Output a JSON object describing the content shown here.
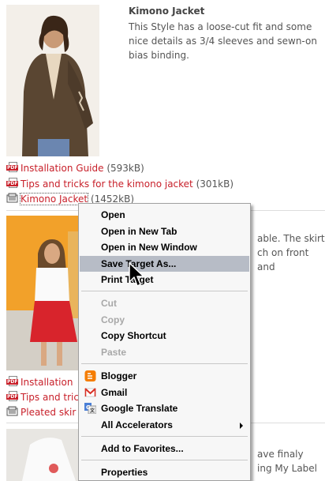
{
  "products": [
    {
      "title": "Kimono Jacket",
      "description": "This Style has a loose-cut fit and some nice details as 3/4 sleeves and sewn-on bias binding.",
      "links": [
        {
          "icon": "pdf-icon",
          "label": "Installation Guide",
          "size": "(593kB)"
        },
        {
          "icon": "pdf-icon",
          "label": "Tips and tricks for the kimono jacket",
          "size": "(301kB)"
        },
        {
          "icon": "document-icon",
          "label": "Kimono Jacket",
          "size": "(1452kB)"
        }
      ]
    },
    {
      "description_partial": [
        "able. The skirt",
        "ch on front and"
      ],
      "links": [
        {
          "icon": "pdf-icon",
          "label": "Installation"
        },
        {
          "icon": "pdf-icon",
          "label": "Tips and tric"
        },
        {
          "icon": "document-icon",
          "label": "Pleated skir"
        }
      ]
    },
    {
      "description_partial": [
        "ave finaly",
        "ing My Label"
      ]
    }
  ],
  "context_menu": {
    "items": [
      {
        "label": "Open",
        "enabled": true
      },
      {
        "label": "Open in New Tab",
        "enabled": true
      },
      {
        "label": "Open in New Window",
        "enabled": true
      },
      {
        "label": "Save Target As...",
        "enabled": true,
        "highlighted": true
      },
      {
        "label": "Print Target",
        "enabled": true
      },
      {
        "label": "Cut",
        "enabled": false
      },
      {
        "label": "Copy",
        "enabled": false
      },
      {
        "label": "Copy Shortcut",
        "enabled": true
      },
      {
        "label": "Paste",
        "enabled": false
      },
      {
        "label": "Blogger",
        "enabled": true,
        "icon": "blogger-icon"
      },
      {
        "label": "Gmail",
        "enabled": true,
        "icon": "gmail-icon"
      },
      {
        "label": "Google Translate",
        "enabled": true,
        "icon": "google-translate-icon"
      },
      {
        "label": "All Accelerators",
        "enabled": true,
        "submenu": true
      },
      {
        "label": "Add to Favorites...",
        "enabled": true
      },
      {
        "label": "Properties",
        "enabled": true
      }
    ]
  },
  "colors": {
    "link": "#c8202a",
    "menu_highlight": "#b7bcc6",
    "disabled": "#a8a8a8"
  }
}
